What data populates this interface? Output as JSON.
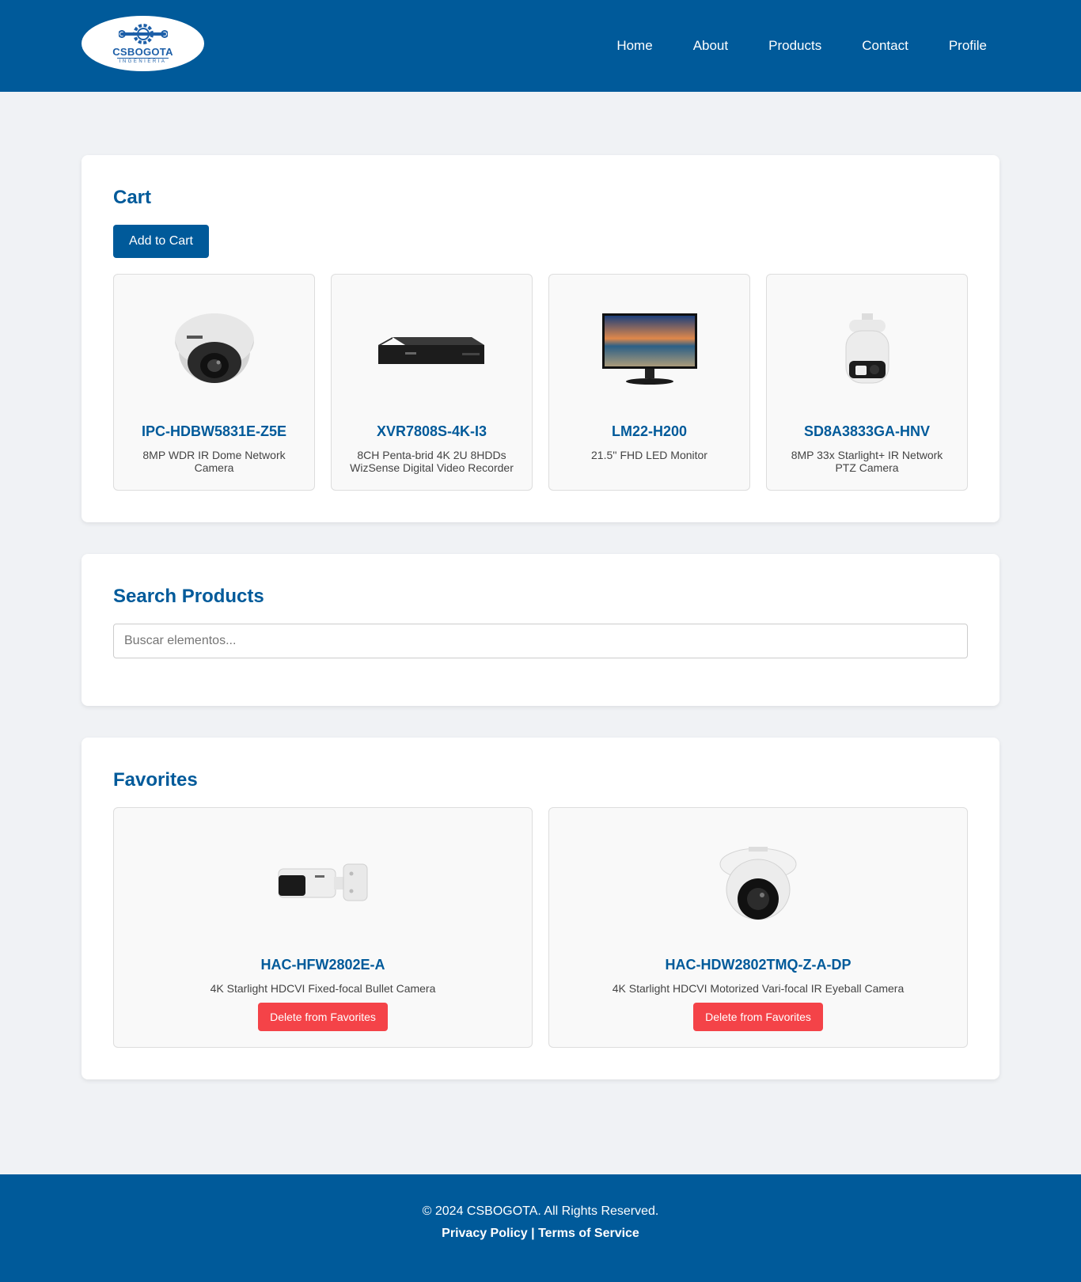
{
  "header": {
    "logo": {
      "name": "CSBOGOTA",
      "tagline": "INGENIERIA"
    },
    "nav": [
      "Home",
      "About",
      "Products",
      "Contact",
      "Profile"
    ]
  },
  "cart": {
    "title": "Cart",
    "add_button": "Add to Cart",
    "items": [
      {
        "model": "IPC-HDBW5831E-Z5E",
        "description": "8MP WDR IR Dome Network Camera",
        "image": "dome-camera-image"
      },
      {
        "model": "XVR7808S-4K-I3",
        "description": "8CH Penta-brid 4K 2U 8HDDs WizSense Digital Video Recorder",
        "image": "video-recorder-image"
      },
      {
        "model": "LM22-H200",
        "description": "21.5'' FHD LED Monitor",
        "image": "monitor-image"
      },
      {
        "model": "SD8A3833GA-HNV",
        "description": "8MP 33x Starlight+ IR Network PTZ Camera",
        "image": "ptz-camera-image"
      }
    ]
  },
  "search": {
    "title": "Search Products",
    "placeholder": "Buscar elementos..."
  },
  "favorites": {
    "title": "Favorites",
    "items": [
      {
        "model": "HAC-HFW2802E-A",
        "description": "4K Starlight HDCVI Fixed-focal Bullet Camera",
        "delete_label": "Delete from Favorites",
        "image": "bullet-camera-image"
      },
      {
        "model": "HAC-HDW2802TMQ-Z-A-DP",
        "description": "4K Starlight HDCVI Motorized Vari-focal IR Eyeball Camera",
        "delete_label": "Delete from Favorites",
        "image": "eyeball-camera-image"
      }
    ]
  },
  "footer": {
    "copyright": "© 2024 CSBOGOTA. All Rights Reserved.",
    "privacy": "Privacy Policy",
    "separator": " | ",
    "terms": "Terms of Service"
  },
  "colors": {
    "brand": "#005a9a",
    "danger": "#f44348",
    "background": "#f0f2f5"
  }
}
